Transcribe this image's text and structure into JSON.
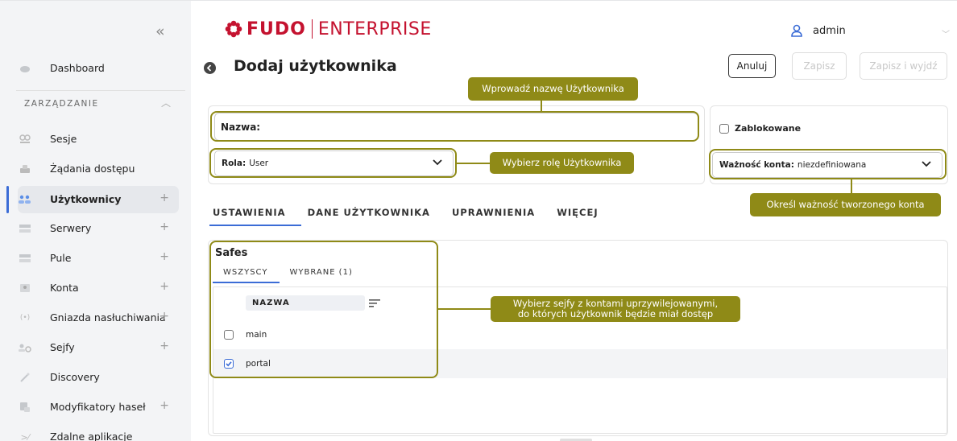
{
  "sidebar": {
    "collapse_icon": "double-chevron-left-icon",
    "section_label": "ZARZĄDZANIE",
    "items": [
      {
        "label": "Dashboard",
        "icon": "dashboard-icon",
        "has_plus": false
      },
      {
        "label": "Sesje",
        "icon": "sessions-icon",
        "has_plus": false
      },
      {
        "label": "Żądania dostępu",
        "icon": "access-requests-icon",
        "has_plus": false
      },
      {
        "label": "Użytkownicy",
        "icon": "users-icon",
        "has_plus": true,
        "active": true
      },
      {
        "label": "Serwery",
        "icon": "servers-icon",
        "has_plus": true
      },
      {
        "label": "Pule",
        "icon": "pools-icon",
        "has_plus": true
      },
      {
        "label": "Konta",
        "icon": "accounts-icon",
        "has_plus": true
      },
      {
        "label": "Gniazda nasłuchiwania",
        "icon": "listeners-icon",
        "has_plus": true
      },
      {
        "label": "Sejfy",
        "icon": "safes-icon",
        "has_plus": true
      },
      {
        "label": "Discovery",
        "icon": "discovery-icon",
        "has_plus": false
      },
      {
        "label": "Modyfikatory haseł",
        "icon": "password-changers-icon",
        "has_plus": true
      },
      {
        "label": "Zdalne aplikacje",
        "icon": "remote-apps-icon",
        "has_plus": false
      }
    ],
    "plus": "+"
  },
  "header": {
    "logo_fudo": "FUDO",
    "logo_enterprise": "ENTERPRISE",
    "user_name": "admin"
  },
  "page": {
    "title": "Dodaj użytkownika",
    "cancel_label": "Anuluj",
    "save_label": "Zapisz",
    "save_exit_label": "Zapisz i wyjdź"
  },
  "form": {
    "name_label": "Nazwa:",
    "role_label": "Rola:",
    "role_value": "User",
    "blocked_label": "Zablokowane",
    "validity_label": "Ważność konta:",
    "validity_value": "niezdefiniowana"
  },
  "tabs": [
    "USTAWIENIA",
    "DANE UŻYTKOWNIKA",
    "UPRAWNIENIA",
    "WIĘCEJ"
  ],
  "safes": {
    "title": "Safes",
    "tab_all": "WSZYSCY",
    "tab_selected": "WYBRANE (1)",
    "column": "NAZWA",
    "rows": [
      {
        "name": "main",
        "checked": false
      },
      {
        "name": "portal",
        "checked": true
      }
    ]
  },
  "tooltips": {
    "name": "Wprowadź nazwę Użytkownika",
    "role": "Wybierz rolę Użytkownika",
    "validity": "Określ ważność tworzonego konta",
    "safes_line1": "Wybierz sejfy z kontami uprzywilejowanymi,",
    "safes_line2": "do których użytkownik będzie miał dostęp"
  },
  "colors": {
    "brand": "#c4122f",
    "accent": "#3b6cd6",
    "annotation": "#8f8a17"
  }
}
